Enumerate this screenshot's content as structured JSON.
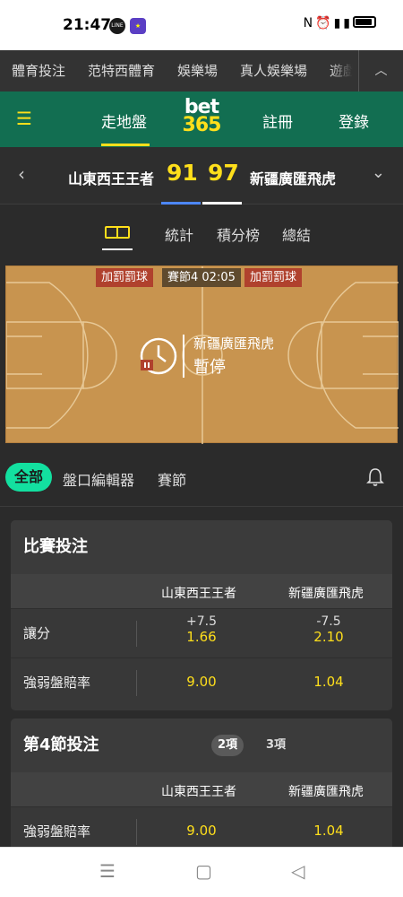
{
  "status_bar": {
    "time": "21:47",
    "icons": [
      "line-icon",
      "game-icon",
      "nfc-icon",
      "alarm-icon",
      "signal-icon",
      "battery-icon"
    ]
  },
  "category_nav": {
    "items": [
      "體育投注",
      "范特西體育",
      "娛樂場",
      "真人娛樂場",
      "遊戲"
    ],
    "more_icon": "chevron-up-icon"
  },
  "header": {
    "menu_icon": "hamburger-icon",
    "live": "走地盤",
    "logo_line1": "bet",
    "logo_line2": "365",
    "register": "註冊",
    "login": "登錄"
  },
  "scoreboard": {
    "home": "山東西王王者",
    "home_score": "91",
    "away_score": "97",
    "away": "新疆廣匯飛虎"
  },
  "sub_tabs": {
    "court_icon": "court-icon",
    "stats": "統計",
    "standings": "積分榜",
    "summary": "總結"
  },
  "court": {
    "left_badge": "加罰罰球",
    "period": "賽節4  02:05",
    "right_badge": "加罰罰球",
    "team": "新疆廣匯飛虎",
    "state": "暫停"
  },
  "filters": {
    "all": "全部",
    "bet_builder": "盤口編輯器",
    "quarters": "賽節"
  },
  "match_betting": {
    "title": "比賽投注",
    "col_home": "山東西王王者",
    "col_away": "新疆廣匯飛虎",
    "rows": [
      {
        "label": "讓分",
        "home_line": "+7.5",
        "home_odds": "1.66",
        "away_line": "-7.5",
        "away_odds": "2.10"
      },
      {
        "label": "強弱盤賠率",
        "home_odds": "9.00",
        "away_odds": "1.04"
      }
    ]
  },
  "quarter_betting": {
    "title": "第4節投注",
    "tab_a": "2項",
    "tab_b": "3項",
    "col_home": "山東西王王者",
    "col_away": "新疆廣匯飛虎",
    "rows": [
      {
        "label": "強弱盤賠率",
        "home_odds": "9.00",
        "away_odds": "1.04"
      }
    ]
  },
  "colors": {
    "brand_green": "#126e51",
    "accent_yellow": "#ffdf1b",
    "pill_green": "#13e0a0",
    "badge_red": "#b0412d"
  }
}
